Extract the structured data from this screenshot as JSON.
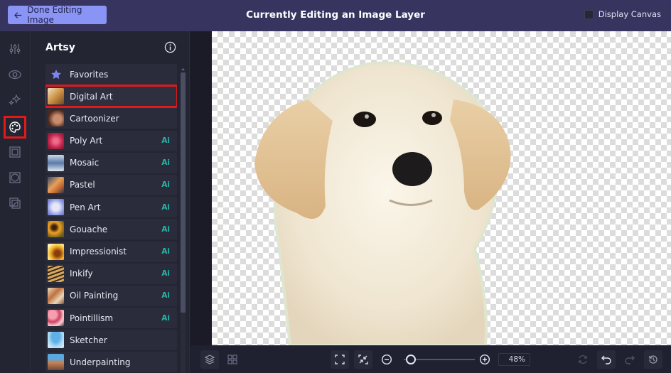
{
  "topbar": {
    "done_button_label": "Done Editing Image",
    "title": "Currently Editing an Image Layer",
    "display_canvas_label": "Display Canvas",
    "display_canvas_checked": false
  },
  "rail": {
    "items": [
      {
        "icon": "sliders-icon",
        "active": false
      },
      {
        "icon": "eye-icon",
        "active": false
      },
      {
        "icon": "sparkles-icon",
        "active": false
      },
      {
        "icon": "palette-icon",
        "active": true
      },
      {
        "icon": "frame-icon",
        "active": false
      },
      {
        "icon": "vignette-icon",
        "active": false
      },
      {
        "icon": "overlay-icon",
        "active": false
      }
    ]
  },
  "panel": {
    "title": "Artsy",
    "info_icon": "info-icon",
    "items": [
      {
        "label": "Favorites",
        "ai": false,
        "thumb": "star"
      },
      {
        "label": "Digital Art",
        "ai": false,
        "selected": true
      },
      {
        "label": "Cartoonizer",
        "ai": false
      },
      {
        "label": "Poly Art",
        "ai": true
      },
      {
        "label": "Mosaic",
        "ai": true
      },
      {
        "label": "Pastel",
        "ai": true
      },
      {
        "label": "Pen Art",
        "ai": true
      },
      {
        "label": "Gouache",
        "ai": true
      },
      {
        "label": "Impressionist",
        "ai": true
      },
      {
        "label": "Inkify",
        "ai": true
      },
      {
        "label": "Oil Painting",
        "ai": true
      },
      {
        "label": "Pointillism",
        "ai": true
      },
      {
        "label": "Sketcher",
        "ai": false
      },
      {
        "label": "Underpainting",
        "ai": false
      }
    ],
    "ai_badge": "Ai"
  },
  "bottombar": {
    "zoom_percent": "48%",
    "zoom_slider_fraction": 0.1
  },
  "colors": {
    "topbar": "#373560",
    "accent": "#8a94f5",
    "ai_badge": "#28b6a8",
    "highlight": "#e01a1a"
  }
}
